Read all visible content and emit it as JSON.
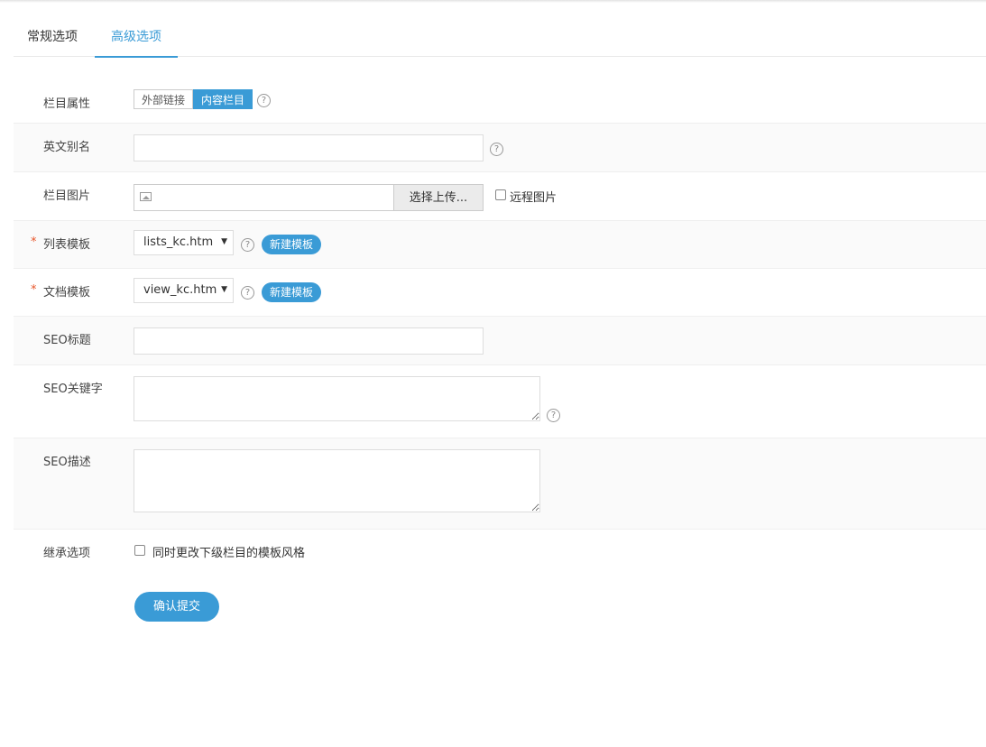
{
  "tabs": {
    "general": "常规选项",
    "advanced": "高级选项"
  },
  "form": {
    "attr": {
      "label": "栏目属性",
      "options": [
        "外部链接",
        "内容栏目"
      ],
      "selected": "内容栏目"
    },
    "alias": {
      "label": "英文别名",
      "value": ""
    },
    "image": {
      "label": "栏目图片",
      "upload_label": "选择上传...",
      "remote_label": "远程图片"
    },
    "list_tpl": {
      "required": "*",
      "label": "列表模板",
      "value": "lists_kc.htm",
      "new_label": "新建模板"
    },
    "doc_tpl": {
      "required": "*",
      "label": "文档模板",
      "value": "view_kc.htm",
      "new_label": "新建模板"
    },
    "seo_title": {
      "label": "SEO标题",
      "value": ""
    },
    "seo_keywords": {
      "label": "SEO关键字",
      "value": ""
    },
    "seo_desc": {
      "label": "SEO描述",
      "value": ""
    },
    "inherit": {
      "label": "继承选项",
      "checkbox_label": "同时更改下级栏目的模板风格"
    },
    "submit_label": "确认提交"
  },
  "icons": {
    "help": "?",
    "dropdown": "▼"
  },
  "colors": {
    "accent": "#3a9bd6",
    "required": "#e8562a"
  }
}
